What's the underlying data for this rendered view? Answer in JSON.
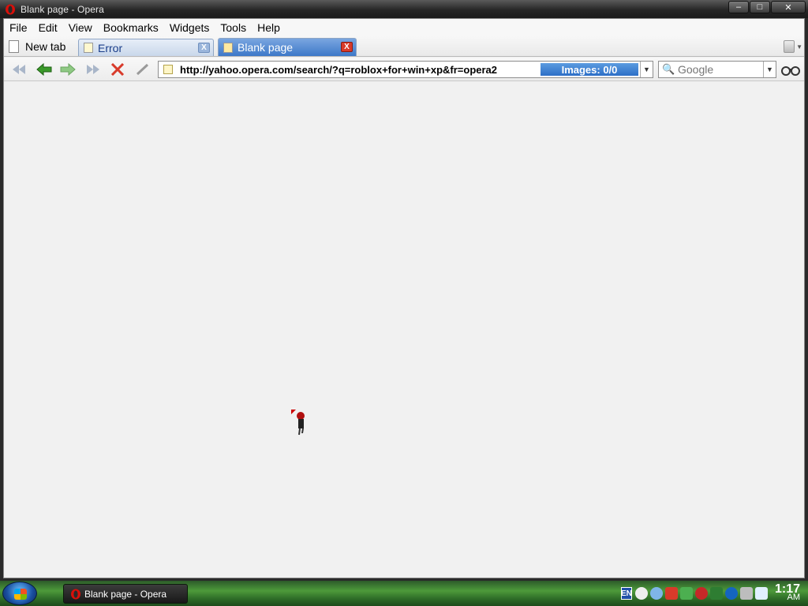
{
  "window": {
    "title": "Blank page - Opera",
    "controls": {
      "minimize": "–",
      "maximize": "□",
      "close": "✕"
    }
  },
  "menu": [
    "File",
    "Edit",
    "View",
    "Bookmarks",
    "Widgets",
    "Tools",
    "Help"
  ],
  "tabs": {
    "new_tab": "New tab",
    "items": [
      {
        "label": "Error",
        "close": "X"
      },
      {
        "label": "Blank page",
        "close": "X"
      }
    ]
  },
  "toolbar": {
    "address": "http://yahoo.opera.com/search/?q=roblox+for+win+xp&fr=opera2",
    "images_status": "Images:   0/0",
    "search_placeholder": "Google",
    "colors": {
      "accent": "#2d6fc7",
      "stop": "#d83a2a",
      "nav_green": "#3a9a2a"
    }
  },
  "taskbar": {
    "task_label": "Blank page - Opera",
    "lang": "EN",
    "clock_time": "1:17",
    "clock_ampm": "AM"
  }
}
